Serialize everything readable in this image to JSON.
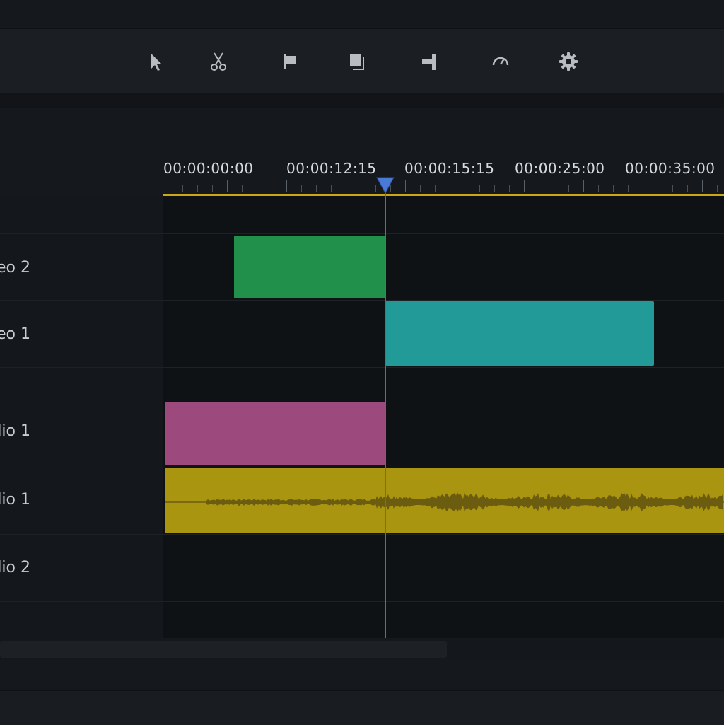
{
  "toolbar": {
    "tools": [
      {
        "icon": "selection-arrow-icon"
      },
      {
        "icon": "razor-scissors-icon"
      },
      {
        "icon": "marker-flag-icon"
      },
      {
        "icon": "overwrite-layers-icon"
      },
      {
        "icon": "trim-edit-icon"
      },
      {
        "icon": "speed-gauge-icon"
      },
      {
        "icon": "settings-gear-icon"
      }
    ]
  },
  "timeline": {
    "timecodes": [
      "00:00:00:00",
      "00:00:12:15",
      "00:00:15:15",
      "00:00:25:00",
      "00:00:35:00"
    ],
    "playhead_time": "00:00:15:15",
    "tracks": [
      {
        "label": "eo 2"
      },
      {
        "label": "eo 1"
      },
      {
        "label": "lio 1"
      },
      {
        "label": "lio 1"
      },
      {
        "label": "lio 2"
      }
    ]
  },
  "colors": {
    "playhead": "#3b6fe0",
    "ruler": "#c9a81a",
    "clip_video2": "#20904a",
    "clip_video1": "#229b98",
    "clip_audio_pink": "#9c4a7e",
    "clip_audio_yellow": "#a9950f"
  }
}
